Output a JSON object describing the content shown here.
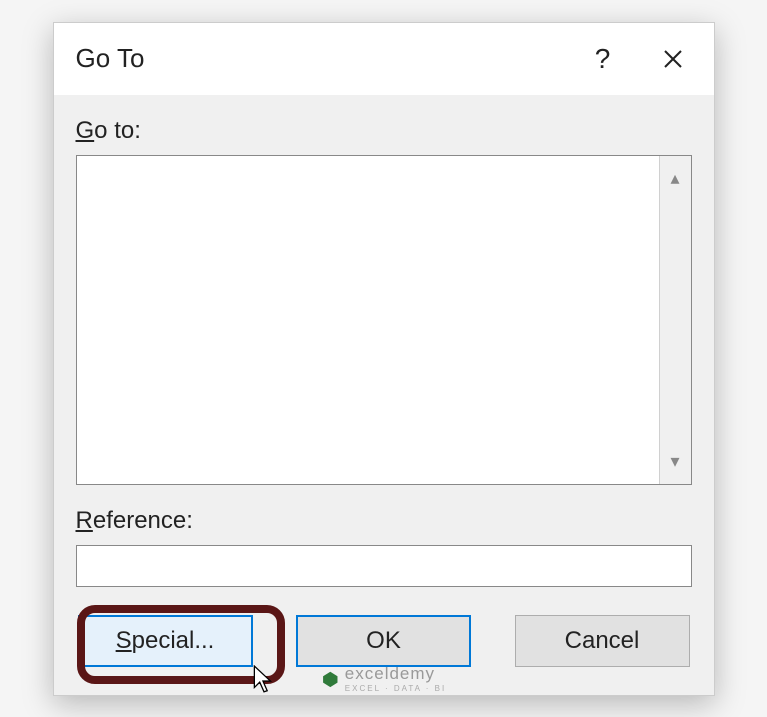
{
  "title": "Go To",
  "labels": {
    "goto": "Go to:",
    "reference": "Reference:"
  },
  "input": {
    "reference_value": ""
  },
  "buttons": {
    "special": "Special...",
    "ok": "OK",
    "cancel": "Cancel"
  },
  "watermark": {
    "brand": "exceldemy",
    "tagline": "EXCEL · DATA · BI"
  }
}
